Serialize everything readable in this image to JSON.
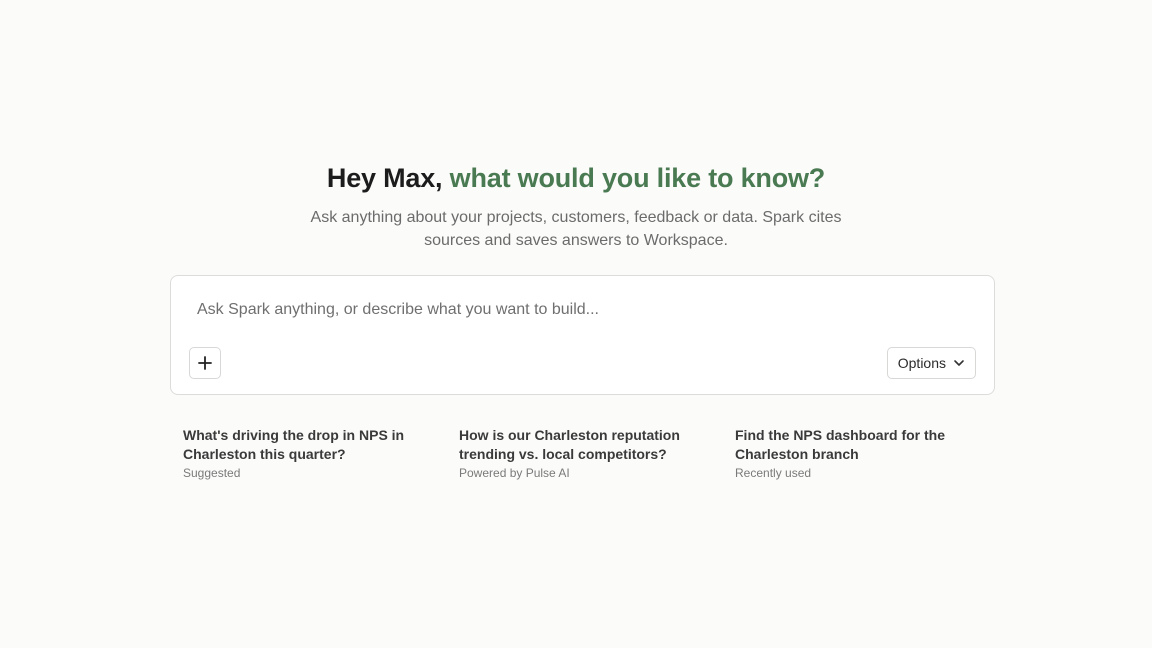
{
  "greeting": {
    "prefix": "Hey Max, ",
    "accent": "what would you like to know?",
    "accent_color": "#4a7a52"
  },
  "subtitle": "Ask anything about your projects, customers, feedback or data. Spark cites sources and saves answers to Workspace.",
  "composer": {
    "placeholder": "Ask Spark anything, or describe what you want to build...",
    "value": "",
    "add_icon": "plus-icon",
    "options_label": "Options",
    "options_icon": "chevron-down-icon"
  },
  "suggestions": [
    {
      "title": "What's driving the drop in NPS in Charleston this quarter?",
      "meta": "Suggested"
    },
    {
      "title": "How is our Charleston reputation trending vs. local competitors?",
      "meta": "Powered by Pulse AI"
    },
    {
      "title": "Find the NPS dashboard for the Charleston branch",
      "meta": "Recently used"
    }
  ]
}
